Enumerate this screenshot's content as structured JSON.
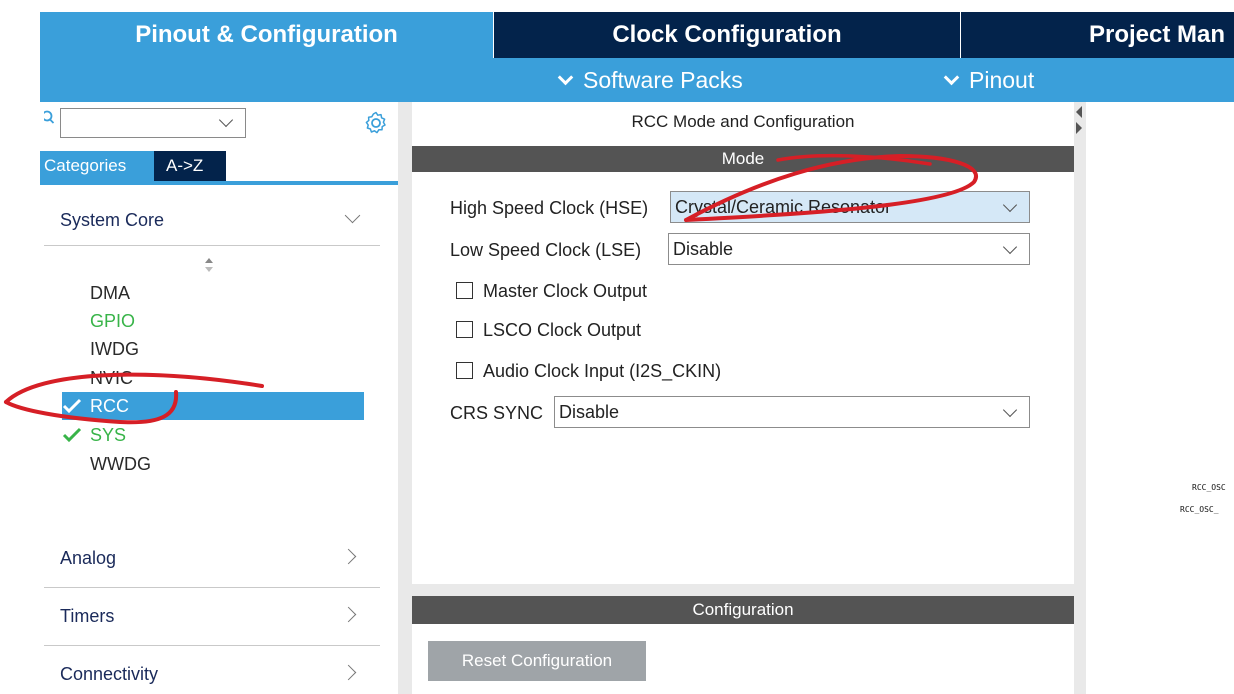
{
  "top_tabs": [
    {
      "label": "Pinout & Configuration",
      "active": true
    },
    {
      "label": "Clock Configuration",
      "active": false
    },
    {
      "label": "Project Man",
      "active": false
    }
  ],
  "sub_menu": {
    "software_packs": "Software Packs",
    "pinout": "Pinout"
  },
  "left_panel": {
    "search_value": "",
    "tabs": {
      "categories": "Categories",
      "atoz": "A->Z"
    },
    "groups": {
      "system_core": "System Core",
      "analog": "Analog",
      "timers": "Timers",
      "connectivity": "Connectivity"
    },
    "peripherals": [
      {
        "label": "DMA",
        "status": "none"
      },
      {
        "label": "GPIO",
        "status": "configured"
      },
      {
        "label": "IWDG",
        "status": "none"
      },
      {
        "label": "NVIC",
        "status": "none"
      },
      {
        "label": "RCC",
        "status": "ok",
        "selected": true
      },
      {
        "label": "SYS",
        "status": "ok"
      },
      {
        "label": "WWDG",
        "status": "none"
      }
    ]
  },
  "center_panel": {
    "title": "RCC Mode and Configuration",
    "mode_header": "Mode",
    "hse": {
      "label": "High Speed Clock (HSE)",
      "value": "Crystal/Ceramic Resonator"
    },
    "lse": {
      "label": "Low Speed Clock (LSE)",
      "value": "Disable"
    },
    "checkboxes": {
      "mco": {
        "label": "Master Clock Output",
        "checked": false
      },
      "lsco": {
        "label": "LSCO Clock Output",
        "checked": false
      },
      "audio": {
        "label": "Audio Clock Input (I2S_CKIN)",
        "checked": false
      }
    },
    "crs": {
      "label": "CRS SYNC",
      "value": "Disable"
    },
    "config_header": "Configuration",
    "reset_button": "Reset Configuration"
  },
  "right_panel": {
    "pin_labels": [
      "RCC_OSC",
      "RCC_OSC_"
    ]
  },
  "colors": {
    "accent_blue": "#3a9fda",
    "navy": "#03234b",
    "header_gray": "#545454",
    "status_green": "#38b449",
    "annotation_red": "#d61f26"
  }
}
